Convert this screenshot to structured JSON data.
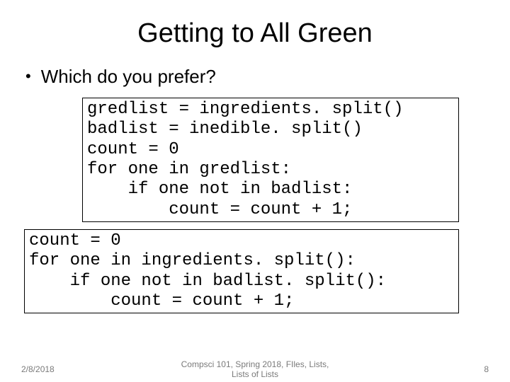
{
  "title": "Getting to All Green",
  "bullet": "Which do you prefer?",
  "code1": "gredlist = ingredients. split()\nbadlist = inedible. split()\ncount = 0\nfor one in gredlist:\n    if one not in badlist:\n        count = count + 1;",
  "code2": "count = 0\nfor one in ingredients. split():\n    if one not in badlist. split():\n        count = count + 1;",
  "footer": {
    "date": "2/8/2018",
    "center_line1": "Compsci 101, Spring 2018, FIles, Lists,",
    "center_line2": "Lists of Lists",
    "page": "8"
  }
}
